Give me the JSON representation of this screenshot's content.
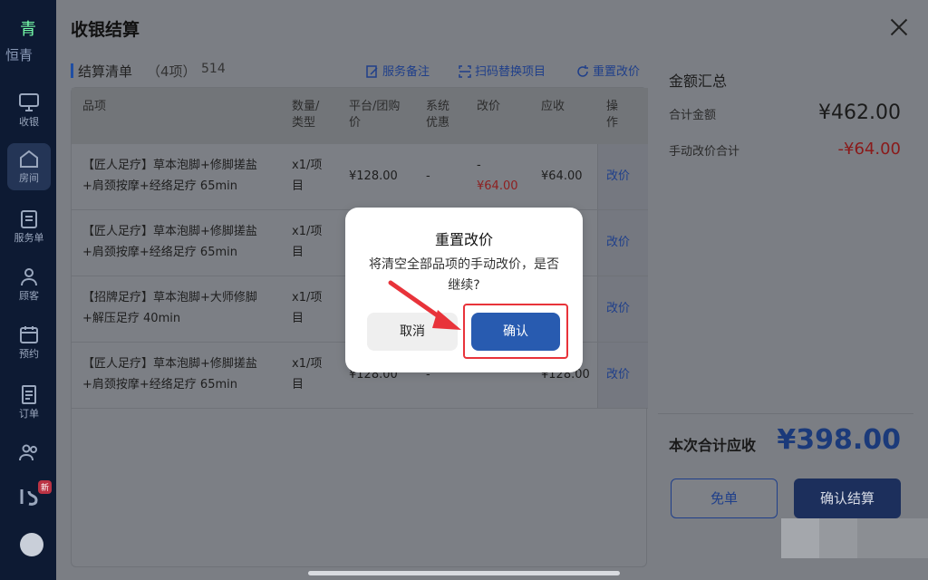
{
  "sidebar": {
    "logo_glyph": "青",
    "logo_text": "恒青",
    "items": [
      {
        "label": "收银",
        "icon": "monitor-icon"
      },
      {
        "label": "房间",
        "icon": "home-icon"
      },
      {
        "label": "服务单",
        "icon": "clipboard-icon"
      },
      {
        "label": "顾客",
        "icon": "user-icon"
      },
      {
        "label": "预约",
        "icon": "calendar-icon"
      },
      {
        "label": "订单",
        "icon": "order-icon"
      },
      {
        "label": "",
        "icon": "users-icon"
      }
    ],
    "badge": "新"
  },
  "panel": {
    "title": "收银结算",
    "list_title": "结算清单",
    "list_count": "（4项）",
    "list_code": "514",
    "tools": {
      "service_note": "服务备注",
      "scan_replace": "扫码替换项目",
      "reset_price": "重置改价"
    },
    "columns": {
      "item": "品项",
      "qty_1": "数量/",
      "qty_2": "类型",
      "price_1": "平台/团购",
      "price_2": "价",
      "disc_1": "系统",
      "disc_2": "优惠",
      "adjust": "改价",
      "due": "应收",
      "op_1": "操",
      "op_2": "作"
    },
    "rows": [
      {
        "name_1": "【匠人足疗】草本泡脚+修脚搓盐",
        "name_2": "+肩颈按摩+经络足疗 65min",
        "qty_1": "x1/项",
        "qty_2": "目",
        "price": "¥128.00",
        "disc": "-",
        "adjust_1": "-",
        "adjust_2": "¥64.00",
        "due": "¥64.00",
        "action": "改价"
      },
      {
        "name_1": "【匠人足疗】草本泡脚+修脚搓盐",
        "name_2": "+肩颈按摩+经络足疗 65min",
        "qty_1": "x1/项",
        "qty_2": "目",
        "price": "",
        "disc": "",
        "adjust_1": "",
        "adjust_2": "",
        "due": "",
        "action": "改价"
      },
      {
        "name_1": "【招牌足疗】草本泡脚+大师修脚",
        "name_2": "+解压足疗 40min",
        "qty_1": "x1/项",
        "qty_2": "目",
        "price": "",
        "disc": "",
        "adjust_1": "",
        "adjust_2": "",
        "due": "",
        "action": "改价"
      },
      {
        "name_1": "【匠人足疗】草本泡脚+修脚搓盐",
        "name_2": "+肩颈按摩+经络足疗 65min",
        "qty_1": "x1/项",
        "qty_2": "目",
        "price": "¥128.00",
        "disc": "-",
        "adjust_1": "",
        "adjust_2": "",
        "due": "¥128.00",
        "action": "改价"
      }
    ]
  },
  "summary": {
    "title": "金额汇总",
    "total_label": "合计金额",
    "total_value": "¥462.00",
    "manual_label": "手动改价合计",
    "manual_value": "-¥64.00",
    "payable_label": "本次合计应收",
    "payable_value": "¥398.00",
    "free_button": "免单",
    "settle_button": "确认结算"
  },
  "dialog": {
    "title": "重置改价",
    "message": "将清空全部品项的手动改价，是否继续?",
    "cancel": "取消",
    "confirm": "确认"
  },
  "colors": {
    "primary": "#285bb0",
    "annotation_red": "#e8333a",
    "price_red": "#e03b3b"
  }
}
